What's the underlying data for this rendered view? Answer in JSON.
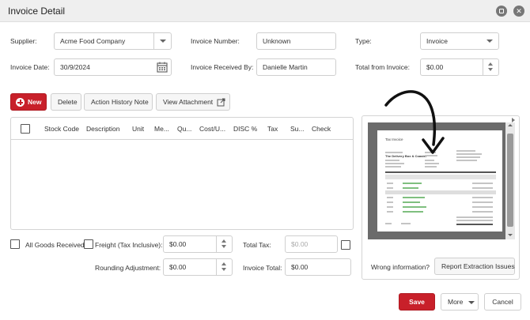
{
  "window": {
    "title": "Invoice Detail"
  },
  "header": {
    "supplier_label": "Supplier:",
    "supplier_value": "Acme Food Company",
    "invoice_number_label": "Invoice Number:",
    "invoice_number_value": "Unknown",
    "type_label": "Type:",
    "type_value": "Invoice",
    "invoice_date_label": "Invoice Date:",
    "invoice_date_value": "30/9/2024",
    "received_by_label": "Invoice Received By:",
    "received_by_value": "Danielle Martin",
    "total_from_invoice_label": "Total from Invoice:",
    "total_from_invoice_value": "$0.00"
  },
  "toolbar": {
    "new_label": "New",
    "delete_label": "Delete",
    "action_history_label": "Action History Note",
    "view_attachment_label": "View Attachment"
  },
  "grid": {
    "columns": [
      "Stock Code",
      "Description",
      "Unit",
      "Me...",
      "Qu...",
      "Cost/U...",
      "DISC %",
      "Tax",
      "Su...",
      "Check"
    ]
  },
  "footer": {
    "all_goods_received_label": "All Goods Received",
    "freight_label": "Freight (Tax Inclusive):",
    "freight_value": "$0.00",
    "total_tax_label": "Total Tax:",
    "total_tax_value": "$0.00",
    "rounding_label": "Rounding Adjustment:",
    "rounding_value": "$0.00",
    "invoice_total_label": "Invoice Total:",
    "invoice_total_value": "$0.00"
  },
  "preview": {
    "doc_heading": "Tax Invoice",
    "doc_company": "The Delivery Box & Coaster",
    "wrong_info_label": "Wrong information?",
    "report_button_label": "Report Extraction Issues"
  },
  "actions": {
    "save_label": "Save",
    "more_label": "More",
    "cancel_label": "Cancel"
  },
  "colors": {
    "accent_red": "#c8202a"
  }
}
